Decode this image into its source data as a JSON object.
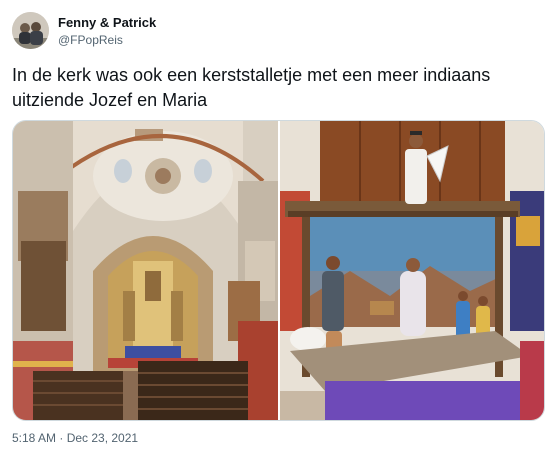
{
  "author": {
    "display_name": "Fenny & Patrick",
    "handle": "@FPopReis"
  },
  "tweet": {
    "text": "In de kerk was ook een kerststalletje met een meer indiaans uitziende Jozef en Maria"
  },
  "media": {
    "photos": [
      {
        "subject": "church-interior-photo"
      },
      {
        "subject": "nativity-scene-photo"
      }
    ]
  },
  "meta": {
    "timestamp": "5:18 AM · Dec 23, 2021"
  }
}
